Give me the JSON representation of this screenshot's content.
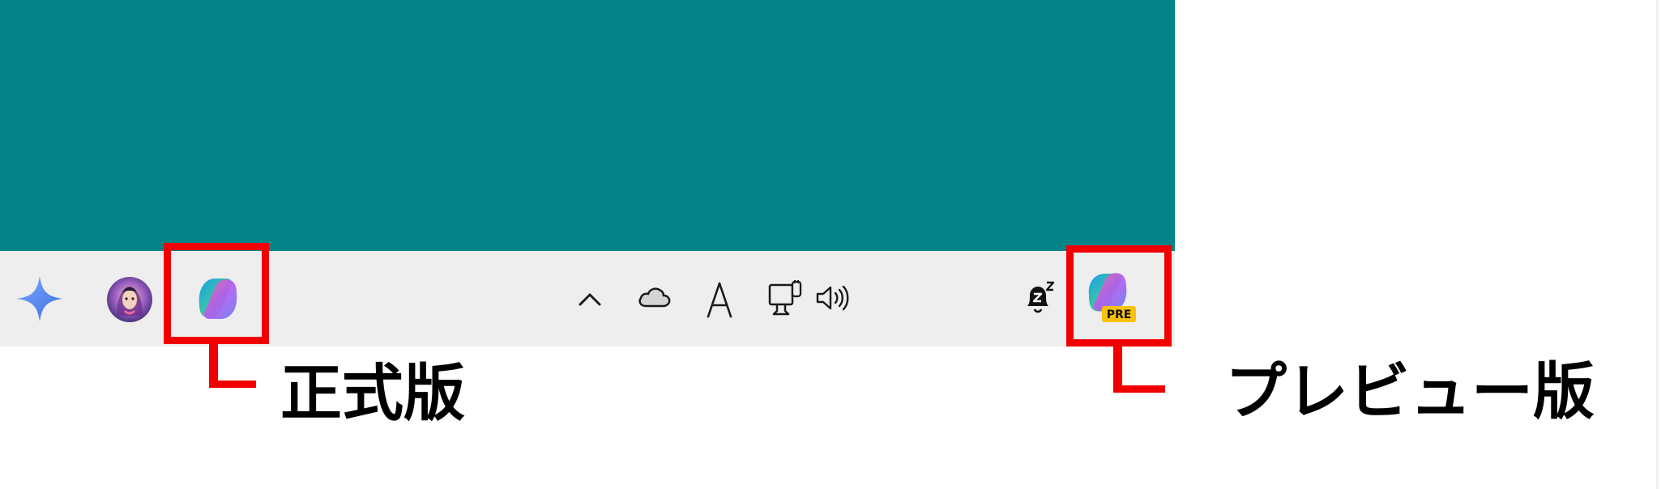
{
  "colors": {
    "desktop_background": "#058488",
    "taskbar_background": "#eeeeee",
    "page_background": "#ffffff",
    "highlight": "#f20000",
    "label_text": "#000000"
  },
  "taskbar": {
    "left_icons": [
      {
        "icon": "sparkle-star-icon"
      },
      {
        "icon": "user-avatar-icon"
      },
      {
        "icon": "copilot-icon"
      }
    ],
    "tray_icons": [
      {
        "icon": "chevron-up-icon"
      },
      {
        "icon": "cloud-icon"
      },
      {
        "icon": "ime-mode-a-icon",
        "glyph": "A"
      },
      {
        "icon": "network-wired-icon"
      },
      {
        "icon": "speaker-volume-icon"
      },
      {
        "icon": "notification-bell-snooze-icon",
        "glyph": "z"
      },
      {
        "icon": "copilot-preview-icon",
        "badge": "PRE"
      }
    ]
  },
  "annotations": {
    "stable": {
      "label": "正式版"
    },
    "preview": {
      "label": "プレビュー版"
    }
  }
}
